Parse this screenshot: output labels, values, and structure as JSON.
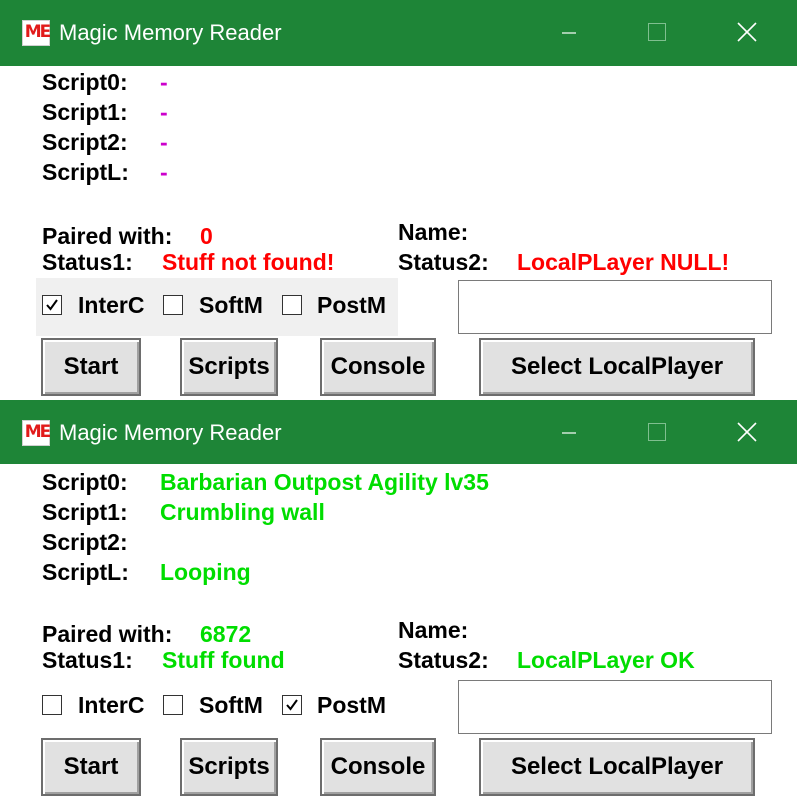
{
  "colors": {
    "titlebar": "#1e8537",
    "value_placeholder": "#cc00cc",
    "status_error": "#ff0000",
    "status_ok": "#00dd00"
  },
  "windows": [
    {
      "title": "Magic Memory Reader",
      "app_icon_text": "ME",
      "scripts": [
        {
          "label": "Script0:",
          "value": "-"
        },
        {
          "label": "Script1:",
          "value": "-"
        },
        {
          "label": "Script2:",
          "value": "-"
        },
        {
          "label": "ScriptL:",
          "value": "-"
        }
      ],
      "paired_label": "Paired with:",
      "paired_value": "0",
      "name_label": "Name:",
      "name_value": "",
      "status1_label": "Status1:",
      "status1_value": "Stuff not found!",
      "status2_label": "Status2:",
      "status2_value": "LocalPLayer NULL!",
      "value_color": "#cc00cc",
      "status_color": "#ff0000",
      "checkboxes": [
        {
          "label": "InterC",
          "checked": true
        },
        {
          "label": "SoftM",
          "checked": false
        },
        {
          "label": "PostM",
          "checked": false
        }
      ],
      "textbox_value": "",
      "buttons": {
        "start": "Start",
        "scripts": "Scripts",
        "console": "Console",
        "select_localplayer": "Select LocalPlayer"
      }
    },
    {
      "title": "Magic Memory Reader",
      "app_icon_text": "ME",
      "scripts": [
        {
          "label": "Script0:",
          "value": "Barbarian Outpost Agility lv35"
        },
        {
          "label": "Script1:",
          "value": "Crumbling wall"
        },
        {
          "label": "Script2:",
          "value": ""
        },
        {
          "label": "ScriptL:",
          "value": "Looping"
        }
      ],
      "paired_label": "Paired with:",
      "paired_value": "6872",
      "name_label": "Name:",
      "name_value": "",
      "status1_label": "Status1:",
      "status1_value": "Stuff found",
      "status2_label": "Status2:",
      "status2_value": "LocalPLayer OK",
      "value_color": "#00dd00",
      "status_color": "#00dd00",
      "checkboxes": [
        {
          "label": "InterC",
          "checked": false
        },
        {
          "label": "SoftM",
          "checked": false
        },
        {
          "label": "PostM",
          "checked": true
        }
      ],
      "textbox_value": "",
      "buttons": {
        "start": "Start",
        "scripts": "Scripts",
        "console": "Console",
        "select_localplayer": "Select LocalPlayer"
      }
    }
  ]
}
